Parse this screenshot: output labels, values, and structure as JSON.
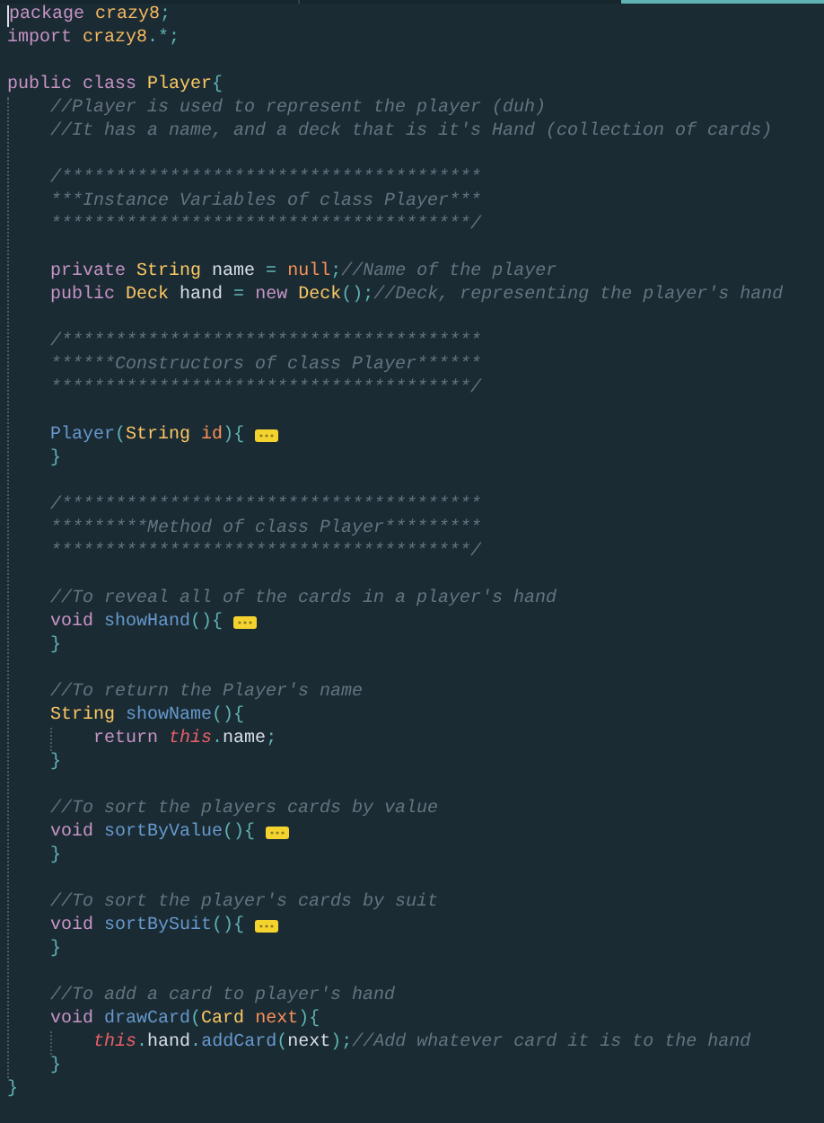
{
  "editor": {
    "lines": [
      {
        "kind": "code",
        "caret": true,
        "tokens": [
          {
            "kind": "keyword",
            "text": "package "
          },
          {
            "kind": "package",
            "text": "crazy8"
          },
          {
            "kind": "punct",
            "text": ";"
          }
        ]
      },
      {
        "kind": "code",
        "tokens": [
          {
            "kind": "keyword",
            "text": "import "
          },
          {
            "kind": "package",
            "text": "crazy8"
          },
          {
            "kind": "punct",
            "text": ".*;"
          }
        ]
      },
      {
        "kind": "blank"
      },
      {
        "kind": "code",
        "folded": false,
        "tokens": [
          {
            "kind": "keyword",
            "text": "public "
          },
          {
            "kind": "keyword",
            "text": "class "
          },
          {
            "kind": "type",
            "text": "Player"
          },
          {
            "kind": "punct",
            "text": "{"
          }
        ],
        "children": [
          {
            "kind": "code",
            "tokens": [
              {
                "kind": "comment",
                "text": "//Player is used to represent the player (duh)"
              }
            ]
          },
          {
            "kind": "code",
            "tokens": [
              {
                "kind": "comment",
                "text": "//It has a name, and a deck that is it's Hand (collection of cards)"
              }
            ]
          },
          {
            "kind": "blank"
          },
          {
            "kind": "code",
            "tokens": [
              {
                "kind": "comment",
                "text": "/***************************************"
              }
            ]
          },
          {
            "kind": "code",
            "tokens": [
              {
                "kind": "comment",
                "text": "***Instance Variables of class Player***"
              }
            ]
          },
          {
            "kind": "code",
            "tokens": [
              {
                "kind": "comment",
                "text": "***************************************/"
              }
            ]
          },
          {
            "kind": "blank"
          },
          {
            "kind": "code",
            "tokens": [
              {
                "kind": "keyword",
                "text": "private "
              },
              {
                "kind": "type",
                "text": "String "
              },
              {
                "kind": "ident",
                "text": "name "
              },
              {
                "kind": "punct",
                "text": "= "
              },
              {
                "kind": "literal",
                "text": "null"
              },
              {
                "kind": "punct",
                "text": ";"
              },
              {
                "kind": "comment",
                "text": "//Name of the player"
              }
            ]
          },
          {
            "kind": "code",
            "tokens": [
              {
                "kind": "keyword",
                "text": "public "
              },
              {
                "kind": "type",
                "text": "Deck "
              },
              {
                "kind": "ident",
                "text": "hand "
              },
              {
                "kind": "punct",
                "text": "= "
              },
              {
                "kind": "keyword",
                "text": "new "
              },
              {
                "kind": "type",
                "text": "Deck"
              },
              {
                "kind": "punct",
                "text": "();"
              },
              {
                "kind": "comment",
                "text": "//Deck, representing the player's hand"
              }
            ]
          },
          {
            "kind": "blank"
          },
          {
            "kind": "code",
            "tokens": [
              {
                "kind": "comment",
                "text": "/***************************************"
              }
            ]
          },
          {
            "kind": "code",
            "tokens": [
              {
                "kind": "comment",
                "text": "******Constructors of class Player******"
              }
            ]
          },
          {
            "kind": "code",
            "tokens": [
              {
                "kind": "comment",
                "text": "***************************************/"
              }
            ]
          },
          {
            "kind": "blank"
          },
          {
            "kind": "code",
            "folded": true,
            "tokens": [
              {
                "kind": "function",
                "text": "Player"
              },
              {
                "kind": "punct",
                "text": "("
              },
              {
                "kind": "type",
                "text": "String "
              },
              {
                "kind": "param",
                "text": "id"
              },
              {
                "kind": "punct",
                "text": "){"
              }
            ]
          },
          {
            "kind": "code",
            "tokens": [
              {
                "kind": "punct",
                "text": "}"
              }
            ]
          },
          {
            "kind": "blank"
          },
          {
            "kind": "code",
            "tokens": [
              {
                "kind": "comment",
                "text": "/***************************************"
              }
            ]
          },
          {
            "kind": "code",
            "tokens": [
              {
                "kind": "comment",
                "text": "*********Method of class Player*********"
              }
            ]
          },
          {
            "kind": "code",
            "tokens": [
              {
                "kind": "comment",
                "text": "***************************************/"
              }
            ]
          },
          {
            "kind": "blank"
          },
          {
            "kind": "code",
            "tokens": [
              {
                "kind": "comment",
                "text": "//To reveal all of the cards in a player's hand"
              }
            ]
          },
          {
            "kind": "code",
            "folded": true,
            "tokens": [
              {
                "kind": "keyword",
                "text": "void "
              },
              {
                "kind": "function",
                "text": "showHand"
              },
              {
                "kind": "punct",
                "text": "(){"
              }
            ]
          },
          {
            "kind": "code",
            "tokens": [
              {
                "kind": "punct",
                "text": "}"
              }
            ]
          },
          {
            "kind": "blank"
          },
          {
            "kind": "code",
            "tokens": [
              {
                "kind": "comment",
                "text": "//To return the Player's name"
              }
            ]
          },
          {
            "kind": "code",
            "folded": false,
            "tokens": [
              {
                "kind": "type",
                "text": "String "
              },
              {
                "kind": "function",
                "text": "showName"
              },
              {
                "kind": "punct",
                "text": "(){"
              }
            ],
            "children": [
              {
                "kind": "code",
                "tokens": [
                  {
                    "kind": "keyword",
                    "text": "return "
                  },
                  {
                    "kind": "this",
                    "text": "this"
                  },
                  {
                    "kind": "punct",
                    "text": "."
                  },
                  {
                    "kind": "ident",
                    "text": "name"
                  },
                  {
                    "kind": "punct",
                    "text": ";"
                  }
                ]
              }
            ]
          },
          {
            "kind": "code",
            "tokens": [
              {
                "kind": "punct",
                "text": "}"
              }
            ]
          },
          {
            "kind": "blank"
          },
          {
            "kind": "code",
            "tokens": [
              {
                "kind": "comment",
                "text": "//To sort the players cards by value"
              }
            ]
          },
          {
            "kind": "code",
            "folded": true,
            "tokens": [
              {
                "kind": "keyword",
                "text": "void "
              },
              {
                "kind": "function",
                "text": "sortByValue"
              },
              {
                "kind": "punct",
                "text": "(){"
              }
            ]
          },
          {
            "kind": "code",
            "tokens": [
              {
                "kind": "punct",
                "text": "}"
              }
            ]
          },
          {
            "kind": "blank"
          },
          {
            "kind": "code",
            "tokens": [
              {
                "kind": "comment",
                "text": "//To sort the player's cards by suit"
              }
            ]
          },
          {
            "kind": "code",
            "folded": true,
            "tokens": [
              {
                "kind": "keyword",
                "text": "void "
              },
              {
                "kind": "function",
                "text": "sortBySuit"
              },
              {
                "kind": "punct",
                "text": "(){"
              }
            ]
          },
          {
            "kind": "code",
            "tokens": [
              {
                "kind": "punct",
                "text": "}"
              }
            ]
          },
          {
            "kind": "blank"
          },
          {
            "kind": "code",
            "tokens": [
              {
                "kind": "comment",
                "text": "//To add a card to player's hand"
              }
            ]
          },
          {
            "kind": "code",
            "folded": false,
            "tokens": [
              {
                "kind": "keyword",
                "text": "void "
              },
              {
                "kind": "function",
                "text": "drawCard"
              },
              {
                "kind": "punct",
                "text": "("
              },
              {
                "kind": "type",
                "text": "Card "
              },
              {
                "kind": "param",
                "text": "next"
              },
              {
                "kind": "punct",
                "text": "){"
              }
            ],
            "children": [
              {
                "kind": "code",
                "tokens": [
                  {
                    "kind": "this",
                    "text": "this"
                  },
                  {
                    "kind": "punct",
                    "text": "."
                  },
                  {
                    "kind": "ident",
                    "text": "hand"
                  },
                  {
                    "kind": "punct",
                    "text": "."
                  },
                  {
                    "kind": "function",
                    "text": "addCard"
                  },
                  {
                    "kind": "punct",
                    "text": "("
                  },
                  {
                    "kind": "ident",
                    "text": "next"
                  },
                  {
                    "kind": "punct",
                    "text": ");"
                  },
                  {
                    "kind": "comment",
                    "text": "//Add whatever card it is to the hand"
                  }
                ]
              }
            ]
          },
          {
            "kind": "code",
            "tokens": [
              {
                "kind": "punct",
                "text": "}"
              }
            ]
          }
        ]
      },
      {
        "kind": "code",
        "tokens": [
          {
            "kind": "punct",
            "text": "}"
          }
        ]
      }
    ]
  }
}
